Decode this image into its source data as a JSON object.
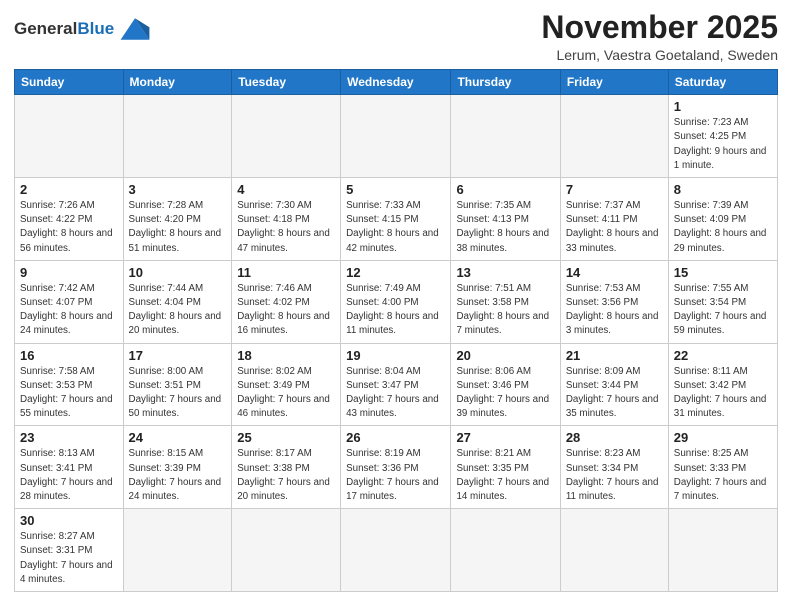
{
  "logo": {
    "text_general": "General",
    "text_blue": "Blue"
  },
  "title": "November 2025",
  "subtitle": "Lerum, Vaestra Goetaland, Sweden",
  "weekdays": [
    "Sunday",
    "Monday",
    "Tuesday",
    "Wednesday",
    "Thursday",
    "Friday",
    "Saturday"
  ],
  "weeks": [
    [
      {
        "day": "",
        "info": ""
      },
      {
        "day": "",
        "info": ""
      },
      {
        "day": "",
        "info": ""
      },
      {
        "day": "",
        "info": ""
      },
      {
        "day": "",
        "info": ""
      },
      {
        "day": "",
        "info": ""
      },
      {
        "day": "1",
        "info": "Sunrise: 7:23 AM\nSunset: 4:25 PM\nDaylight: 9 hours and 1 minute."
      }
    ],
    [
      {
        "day": "2",
        "info": "Sunrise: 7:26 AM\nSunset: 4:22 PM\nDaylight: 8 hours and 56 minutes."
      },
      {
        "day": "3",
        "info": "Sunrise: 7:28 AM\nSunset: 4:20 PM\nDaylight: 8 hours and 51 minutes."
      },
      {
        "day": "4",
        "info": "Sunrise: 7:30 AM\nSunset: 4:18 PM\nDaylight: 8 hours and 47 minutes."
      },
      {
        "day": "5",
        "info": "Sunrise: 7:33 AM\nSunset: 4:15 PM\nDaylight: 8 hours and 42 minutes."
      },
      {
        "day": "6",
        "info": "Sunrise: 7:35 AM\nSunset: 4:13 PM\nDaylight: 8 hours and 38 minutes."
      },
      {
        "day": "7",
        "info": "Sunrise: 7:37 AM\nSunset: 4:11 PM\nDaylight: 8 hours and 33 minutes."
      },
      {
        "day": "8",
        "info": "Sunrise: 7:39 AM\nSunset: 4:09 PM\nDaylight: 8 hours and 29 minutes."
      }
    ],
    [
      {
        "day": "9",
        "info": "Sunrise: 7:42 AM\nSunset: 4:07 PM\nDaylight: 8 hours and 24 minutes."
      },
      {
        "day": "10",
        "info": "Sunrise: 7:44 AM\nSunset: 4:04 PM\nDaylight: 8 hours and 20 minutes."
      },
      {
        "day": "11",
        "info": "Sunrise: 7:46 AM\nSunset: 4:02 PM\nDaylight: 8 hours and 16 minutes."
      },
      {
        "day": "12",
        "info": "Sunrise: 7:49 AM\nSunset: 4:00 PM\nDaylight: 8 hours and 11 minutes."
      },
      {
        "day": "13",
        "info": "Sunrise: 7:51 AM\nSunset: 3:58 PM\nDaylight: 8 hours and 7 minutes."
      },
      {
        "day": "14",
        "info": "Sunrise: 7:53 AM\nSunset: 3:56 PM\nDaylight: 8 hours and 3 minutes."
      },
      {
        "day": "15",
        "info": "Sunrise: 7:55 AM\nSunset: 3:54 PM\nDaylight: 7 hours and 59 minutes."
      }
    ],
    [
      {
        "day": "16",
        "info": "Sunrise: 7:58 AM\nSunset: 3:53 PM\nDaylight: 7 hours and 55 minutes."
      },
      {
        "day": "17",
        "info": "Sunrise: 8:00 AM\nSunset: 3:51 PM\nDaylight: 7 hours and 50 minutes."
      },
      {
        "day": "18",
        "info": "Sunrise: 8:02 AM\nSunset: 3:49 PM\nDaylight: 7 hours and 46 minutes."
      },
      {
        "day": "19",
        "info": "Sunrise: 8:04 AM\nSunset: 3:47 PM\nDaylight: 7 hours and 43 minutes."
      },
      {
        "day": "20",
        "info": "Sunrise: 8:06 AM\nSunset: 3:46 PM\nDaylight: 7 hours and 39 minutes."
      },
      {
        "day": "21",
        "info": "Sunrise: 8:09 AM\nSunset: 3:44 PM\nDaylight: 7 hours and 35 minutes."
      },
      {
        "day": "22",
        "info": "Sunrise: 8:11 AM\nSunset: 3:42 PM\nDaylight: 7 hours and 31 minutes."
      }
    ],
    [
      {
        "day": "23",
        "info": "Sunrise: 8:13 AM\nSunset: 3:41 PM\nDaylight: 7 hours and 28 minutes."
      },
      {
        "day": "24",
        "info": "Sunrise: 8:15 AM\nSunset: 3:39 PM\nDaylight: 7 hours and 24 minutes."
      },
      {
        "day": "25",
        "info": "Sunrise: 8:17 AM\nSunset: 3:38 PM\nDaylight: 7 hours and 20 minutes."
      },
      {
        "day": "26",
        "info": "Sunrise: 8:19 AM\nSunset: 3:36 PM\nDaylight: 7 hours and 17 minutes."
      },
      {
        "day": "27",
        "info": "Sunrise: 8:21 AM\nSunset: 3:35 PM\nDaylight: 7 hours and 14 minutes."
      },
      {
        "day": "28",
        "info": "Sunrise: 8:23 AM\nSunset: 3:34 PM\nDaylight: 7 hours and 11 minutes."
      },
      {
        "day": "29",
        "info": "Sunrise: 8:25 AM\nSunset: 3:33 PM\nDaylight: 7 hours and 7 minutes."
      }
    ],
    [
      {
        "day": "30",
        "info": "Sunrise: 8:27 AM\nSunset: 3:31 PM\nDaylight: 7 hours and 4 minutes."
      },
      {
        "day": "",
        "info": ""
      },
      {
        "day": "",
        "info": ""
      },
      {
        "day": "",
        "info": ""
      },
      {
        "day": "",
        "info": ""
      },
      {
        "day": "",
        "info": ""
      },
      {
        "day": "",
        "info": ""
      }
    ]
  ]
}
